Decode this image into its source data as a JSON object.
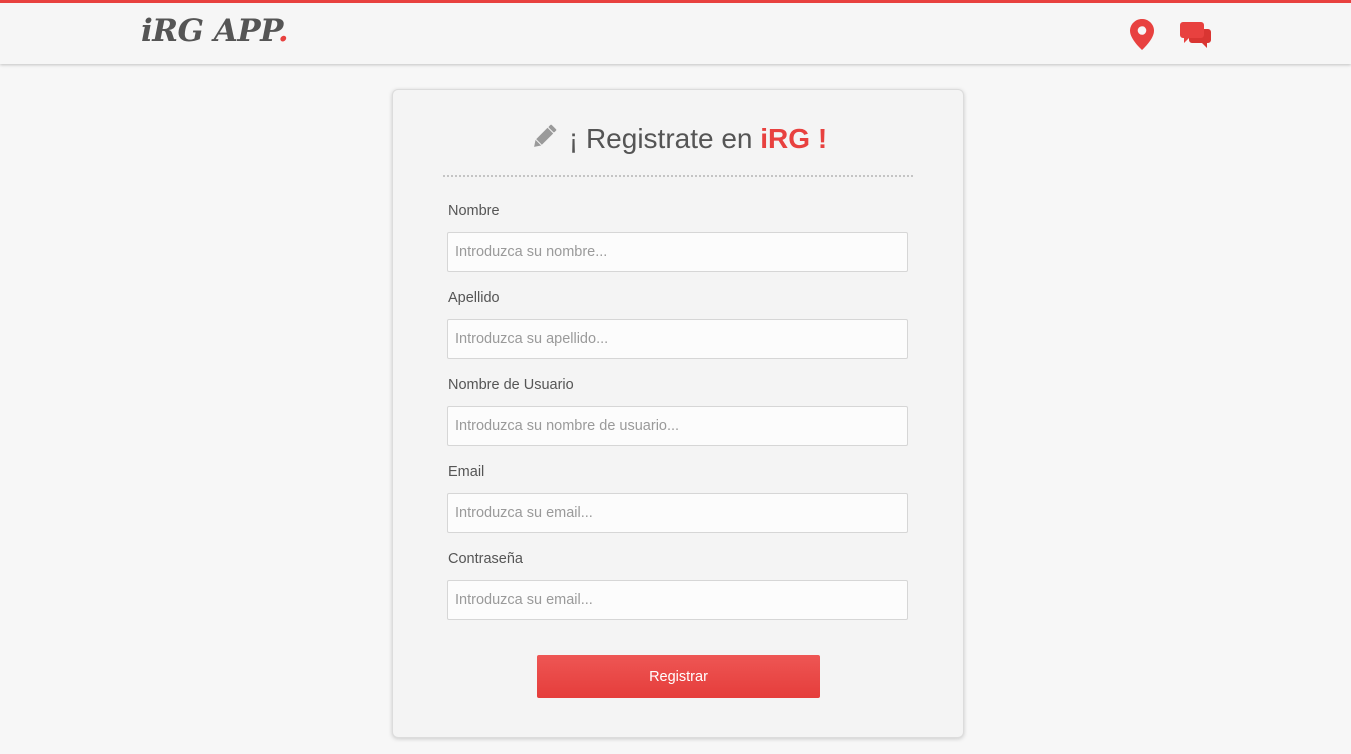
{
  "header": {
    "logo_text": "iRG APP",
    "logo_dot": ".",
    "icons": [
      "map-marker-icon",
      "chat-bubbles-icon"
    ],
    "accent_color": "#e8413f"
  },
  "form": {
    "title_prefix": "¡ Registrate en ",
    "title_brand": "iRG !",
    "fields": [
      {
        "label": "Nombre",
        "placeholder": "Introduzca su nombre..."
      },
      {
        "label": "Apellido",
        "placeholder": "Introduzca su apellido..."
      },
      {
        "label": "Nombre de Usuario",
        "placeholder": "Introduzca su nombre de usuario..."
      },
      {
        "label": "Email",
        "placeholder": "Introduzca su email..."
      },
      {
        "label": "Contraseña",
        "placeholder": "Introduzca su email..."
      }
    ],
    "submit_label": "Registrar"
  }
}
